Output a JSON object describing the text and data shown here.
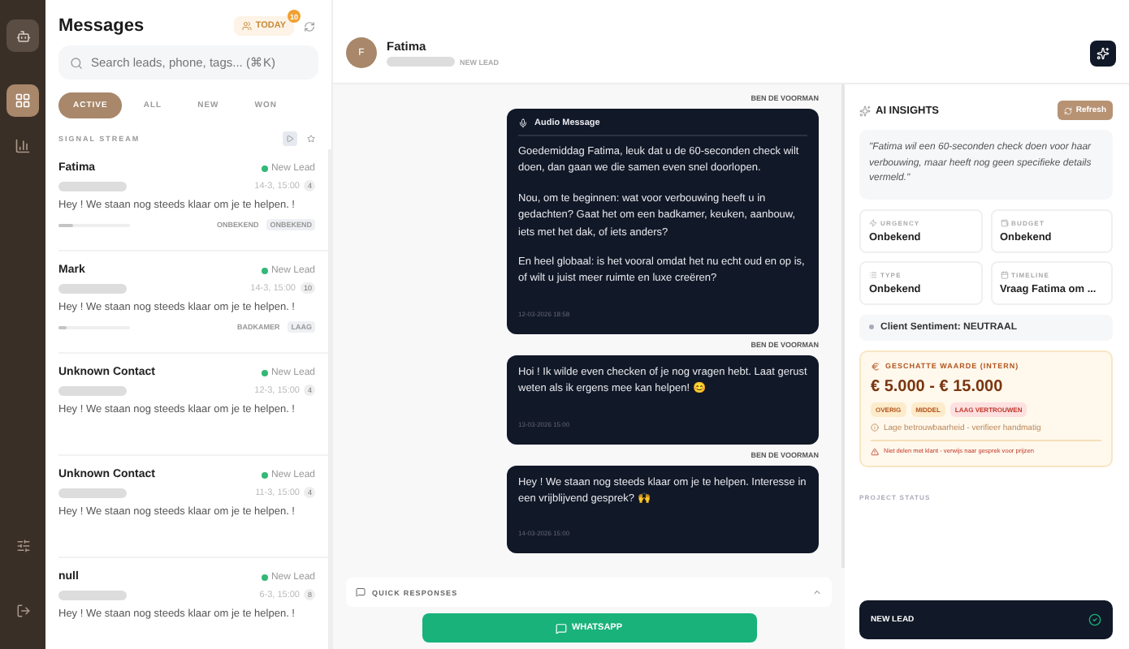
{
  "rail": {
    "items": [
      {
        "selected": true
      },
      {
        "selected": false
      }
    ]
  },
  "inbox": {
    "title": "Messages",
    "today": {
      "label": "TODAY",
      "badge": "10"
    },
    "search": {
      "placeholder": "Search leads, phone, tags... (⌘K)"
    },
    "filters": [
      {
        "label": "ACTIVE",
        "selected": true
      },
      {
        "label": "ALL",
        "selected": false
      },
      {
        "label": "NEW",
        "selected": false
      },
      {
        "label": "WON",
        "selected": false
      }
    ],
    "stream_label": "SIGNAL STREAM",
    "stream_buttons": [
      {
        "selected": true
      },
      {
        "selected": false
      }
    ],
    "leads": [
      {
        "name": "Fatima",
        "status": "New Lead",
        "time": "14-3, 15:00",
        "count": "4",
        "preview": "Hey ! We staan nog steeds klaar om je te helpen. !",
        "level": 0.2,
        "tags": [
          {
            "label": "ONBEKEND",
            "filled": false
          },
          {
            "label": "ONBEKEND",
            "filled": true
          }
        ]
      },
      {
        "name": "Mark",
        "status": "New Lead",
        "time": "14-3, 15:00",
        "count": "10",
        "preview": "Hey ! We staan nog steeds klaar om je te helpen. !",
        "level": 0.12,
        "tags": [
          {
            "label": "BADKAMER",
            "filled": false
          },
          {
            "label": "LAAG",
            "filled": true
          }
        ]
      },
      {
        "name": "Unknown Contact",
        "status": "New Lead",
        "time": "12-3, 15:00",
        "count": "4",
        "preview": "Hey ! We staan nog steeds klaar om je te helpen. !"
      },
      {
        "name": "Unknown Contact",
        "status": "New Lead",
        "time": "11-3, 15:00",
        "count": "4",
        "preview": "Hey ! We staan nog steeds klaar om je te helpen. !"
      },
      {
        "name": "null",
        "status": "New Lead",
        "time": "6-3, 15:00",
        "count": "8",
        "preview": "Hey ! We staan nog steeds klaar om je te helpen. !"
      }
    ]
  },
  "chat": {
    "contact": {
      "initial": "F",
      "name": "Fatima",
      "status": "NEW LEAD"
    },
    "messages": [
      {
        "sender": "BEN DE VOORMAN",
        "kind": "audio",
        "audio_label": "Audio Message",
        "paragraphs": [
          "Goedemiddag Fatima, leuk dat u de 60-seconden check wilt doen, dan gaan we die samen even snel doorlopen.",
          "Nou, om te beginnen: wat voor verbouwing heeft u in gedachten? Gaat het om een badkamer, keuken, aanbouw, iets met het dak, of iets anders?",
          "En heel globaal: is het vooral omdat het nu echt oud en op is, of wilt u juist meer ruimte en luxe creëren?"
        ],
        "time": "12-03-2026 18:58"
      },
      {
        "sender": "BEN DE VOORMAN",
        "kind": "text",
        "paragraphs": [
          "Hoi ! Ik wilde even checken of je nog vragen hebt. Laat gerust weten als ik ergens mee kan helpen! 😊"
        ],
        "time": "13-03-2026 15:00"
      },
      {
        "sender": "BEN DE VOORMAN",
        "kind": "text",
        "paragraphs": [
          "Hey ! We staan nog steeds klaar om je te helpen. Interesse in een vrijblijvend gesprek? 🙌"
        ],
        "time": "14-03-2026 15:00"
      }
    ],
    "quick_responses": {
      "label": "QUICK RESPONSES",
      "expanded": false
    },
    "send_button": "WHATSAPP"
  },
  "insights": {
    "title": "AI INSIGHTS",
    "refresh": "Refresh",
    "summary": "\"Fatima wil een 60-seconden check doen voor haar verbouwing, maar heeft nog geen specifieke details vermeld.\"",
    "facts": [
      {
        "label": "URGENCY",
        "value": "Onbekend"
      },
      {
        "label": "BUDGET",
        "value": "Onbekend"
      },
      {
        "label": "TYPE",
        "value": "Onbekend"
      },
      {
        "label": "TIMELINE",
        "value": "Vraag Fatima om ..."
      }
    ],
    "sentiment": "Client Sentiment: NEUTRAAL",
    "estimate": {
      "title": "GESCHATTE WAARDE (INTERN)",
      "value": "€ 5.000 - € 15.000",
      "tags": [
        {
          "label": "OVERIG",
          "kind": "info"
        },
        {
          "label": "MIDDEL",
          "kind": "info"
        },
        {
          "label": "LAAG VERTROUWEN",
          "kind": "alert"
        }
      ],
      "note": "Lage betrouwbaarheid - verifieer handmatig",
      "warning": "Niet delen met klant - verwijs naar gesprek voor prijzen"
    },
    "project_status_label": "PROJECT STATUS",
    "project_status": {
      "label": "NEW LEAD",
      "done": true
    }
  }
}
